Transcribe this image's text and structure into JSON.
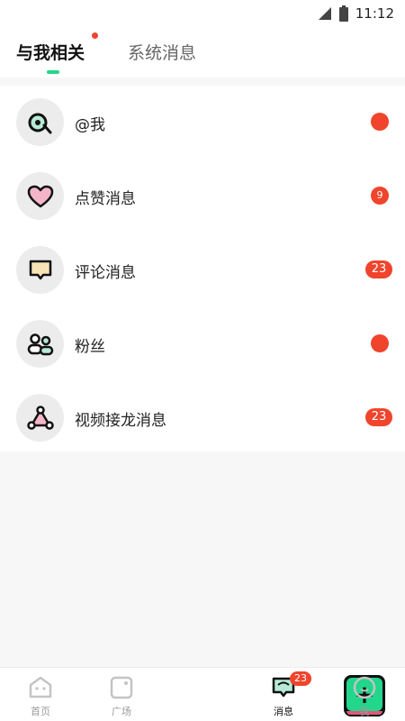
{
  "status_bar": {
    "time": "11:12"
  },
  "header": {
    "tabs": [
      {
        "label": "与我相关",
        "active": true
      },
      {
        "label": "系统消息",
        "active": false
      }
    ]
  },
  "messages": [
    {
      "label": "@我",
      "badge": "",
      "icon": "at-me-icon"
    },
    {
      "label": "点赞消息",
      "badge": "9",
      "icon": "heart-icon"
    },
    {
      "label": "评论消息",
      "badge": "23",
      "icon": "comment-icon"
    },
    {
      "label": "粉丝",
      "badge": "",
      "icon": "fans-icon"
    },
    {
      "label": "视频接龙消息",
      "badge": "23",
      "icon": "video-chain-icon"
    }
  ],
  "bottom_nav": {
    "items": [
      {
        "label": "首页",
        "icon": "home-icon",
        "active": false
      },
      {
        "label": "广场",
        "icon": "plaza-icon",
        "active": false
      },
      {
        "label": "",
        "icon": "plus-icon",
        "active": false
      },
      {
        "label": "消息",
        "icon": "message-icon",
        "active": true,
        "badge": "23"
      },
      {
        "label": "我",
        "icon": "profile-icon",
        "active": false
      }
    ]
  },
  "colors": {
    "accent": "#22d68c",
    "badge": "#f0442d",
    "pink": "#f5b5c8"
  }
}
